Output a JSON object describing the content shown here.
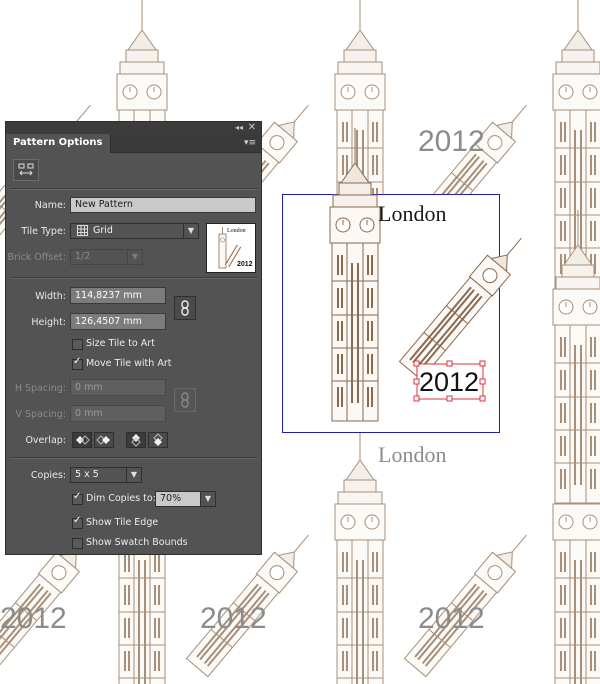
{
  "canvas": {
    "label_london": "London",
    "label_year": "2012"
  },
  "panel": {
    "title": "Pattern Options",
    "name_label": "Name:",
    "name_value": "New Pattern",
    "tile_type_label": "Tile Type:",
    "tile_type_value": "Grid",
    "brick_offset_label": "Brick Offset:",
    "brick_offset_value": "1/2",
    "width_label": "Width:",
    "width_value": "114,8237 mm",
    "height_label": "Height:",
    "height_value": "126,4507 mm",
    "size_tile_to_art": {
      "label": "Size Tile to Art",
      "checked": false
    },
    "move_tile_with_art": {
      "label": "Move Tile with Art",
      "checked": true
    },
    "h_spacing_label": "H Spacing:",
    "h_spacing_value": "0 mm",
    "v_spacing_label": "V Spacing:",
    "v_spacing_value": "0 mm",
    "overlap_label": "Overlap:",
    "copies_label": "Copies:",
    "copies_value": "5 x 5",
    "dim_copies": {
      "label": "Dim Copies to:",
      "checked": true,
      "value": "70%"
    },
    "show_tile_edge": {
      "label": "Show Tile Edge",
      "checked": true
    },
    "show_swatch_bounds": {
      "label": "Show Swatch Bounds",
      "checked": false
    },
    "thumb_top_text": "London",
    "thumb_bottom_text": "2012"
  },
  "colors": {
    "art_brown": "#8a6a4e",
    "panel_bg": "#535353",
    "tile_edge": "#1f1fa8",
    "selection": "#e0303a"
  }
}
